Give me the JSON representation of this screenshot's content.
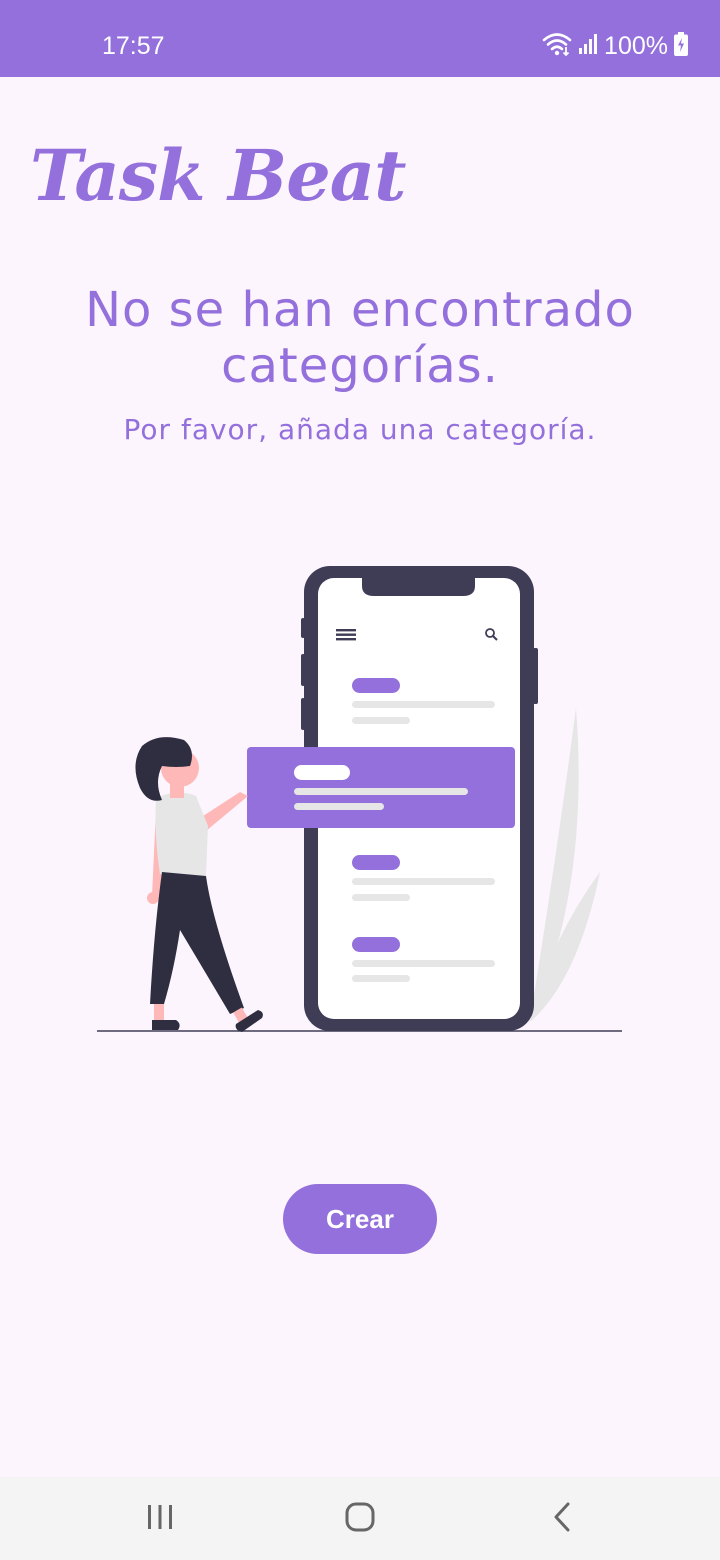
{
  "status_bar": {
    "time": "17:57",
    "battery": "100%",
    "icons": [
      "wifi-icon",
      "signal-icon",
      "battery-charging-icon"
    ]
  },
  "app": {
    "title": "Task Beat"
  },
  "empty_state": {
    "title": "No se han encontrado categorías.",
    "subtitle": "Por favor, añada una categoría."
  },
  "actions": {
    "create_label": "Crear"
  },
  "nav_bar": {
    "icons": [
      "recent-apps-icon",
      "home-icon",
      "back-icon"
    ]
  },
  "colors": {
    "accent": "#9370db",
    "background": "#fdf5fd",
    "phone_frame": "#3f3d56",
    "nav_background": "#f4f4f4"
  }
}
